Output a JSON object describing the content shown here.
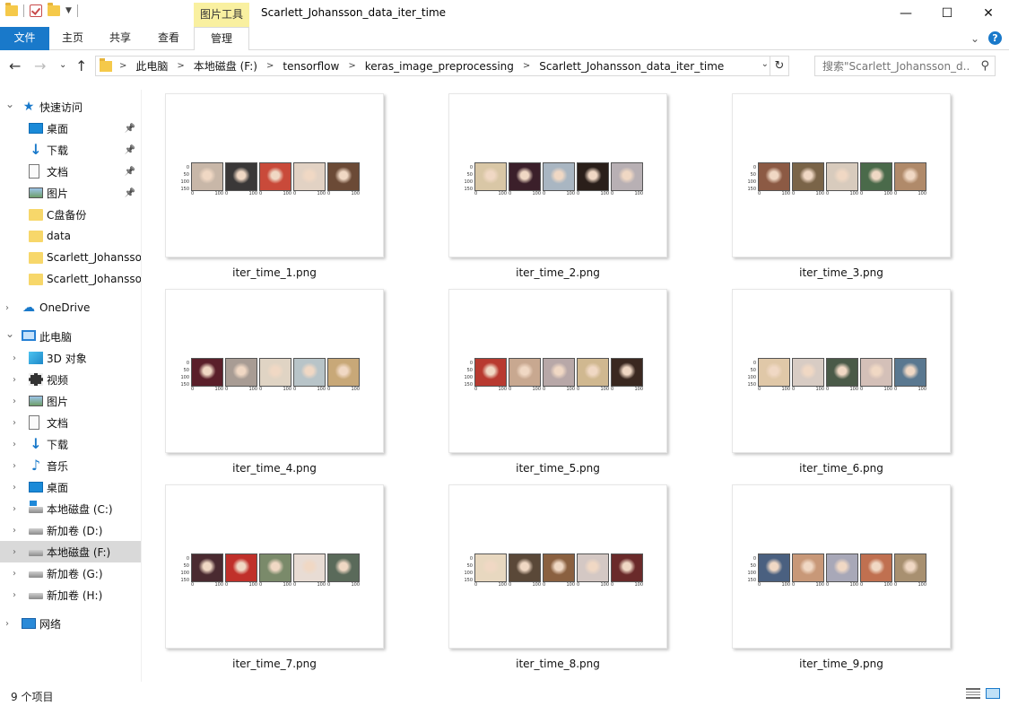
{
  "window": {
    "title": "Scarlett_Johansson_data_iter_time",
    "context_tool": "图片工具",
    "minimize": "—",
    "maximize": "☐",
    "close": "✕"
  },
  "ribbon": {
    "tabs": [
      {
        "label": "文件"
      },
      {
        "label": "主页"
      },
      {
        "label": "共享"
      },
      {
        "label": "查看"
      },
      {
        "label": "管理"
      }
    ],
    "help": "?"
  },
  "address": {
    "crumbs": [
      "此电脑",
      "本地磁盘 (F:)",
      "tensorflow",
      "keras_image_preprocessing",
      "Scarlett_Johansson_data_iter_time"
    ],
    "search_placeholder": "搜索\"Scarlett_Johansson_d...",
    "separator": ">"
  },
  "sidebar": {
    "items": [
      {
        "label": "快速访问",
        "icon": "star-icon",
        "expandable": true,
        "expanded": true
      },
      {
        "label": "桌面",
        "icon": "desktop-icon",
        "pinned": true
      },
      {
        "label": "下载",
        "icon": "download-icon",
        "pinned": true
      },
      {
        "label": "文档",
        "icon": "document-icon",
        "pinned": true
      },
      {
        "label": "图片",
        "icon": "pictures-icon",
        "pinned": true
      },
      {
        "label": "C盘备份",
        "icon": "folder-icon"
      },
      {
        "label": "data",
        "icon": "folder-icon"
      },
      {
        "label": "Scarlett_Johansso",
        "icon": "folder-icon"
      },
      {
        "label": "Scarlett_Johansso",
        "icon": "folder-icon"
      },
      {
        "label": "OneDrive",
        "icon": "cloud-icon",
        "expandable": true
      },
      {
        "label": "此电脑",
        "icon": "computer-icon",
        "expandable": true,
        "expanded": true
      },
      {
        "label": "3D 对象",
        "icon": "3d-objects-icon",
        "expandable": true
      },
      {
        "label": "视频",
        "icon": "video-icon",
        "expandable": true
      },
      {
        "label": "图片",
        "icon": "pictures-icon",
        "expandable": true
      },
      {
        "label": "文档",
        "icon": "document-icon",
        "expandable": true
      },
      {
        "label": "下载",
        "icon": "download-icon",
        "expandable": true
      },
      {
        "label": "音乐",
        "icon": "music-icon",
        "expandable": true
      },
      {
        "label": "桌面",
        "icon": "desktop-icon",
        "expandable": true
      },
      {
        "label": "本地磁盘 (C:)",
        "icon": "system-drive-icon",
        "expandable": true
      },
      {
        "label": "新加卷 (D:)",
        "icon": "drive-icon",
        "expandable": true
      },
      {
        "label": "本地磁盘 (F:)",
        "icon": "drive-icon",
        "expandable": true,
        "selected": true
      },
      {
        "label": "新加卷 (G:)",
        "icon": "drive-icon",
        "expandable": true
      },
      {
        "label": "新加卷 (H:)",
        "icon": "drive-icon",
        "expandable": true
      },
      {
        "label": "网络",
        "icon": "network-icon",
        "expandable": true
      }
    ]
  },
  "files": [
    {
      "name": "iter_time_1.png"
    },
    {
      "name": "iter_time_2.png"
    },
    {
      "name": "iter_time_3.png"
    },
    {
      "name": "iter_time_4.png"
    },
    {
      "name": "iter_time_5.png"
    },
    {
      "name": "iter_time_6.png"
    },
    {
      "name": "iter_time_7.png"
    },
    {
      "name": "iter_time_8.png"
    },
    {
      "name": "iter_time_9.png"
    }
  ],
  "thumb_axis": {
    "y_ticks": [
      "0",
      "50",
      "100",
      "150"
    ],
    "x_ticks": [
      "0",
      "100"
    ]
  },
  "status": {
    "count": "9 个项目"
  },
  "colors": {
    "accent": "#1979ca",
    "context_tab": "#f9f0a0",
    "selected_row": "#d9d9d9"
  }
}
